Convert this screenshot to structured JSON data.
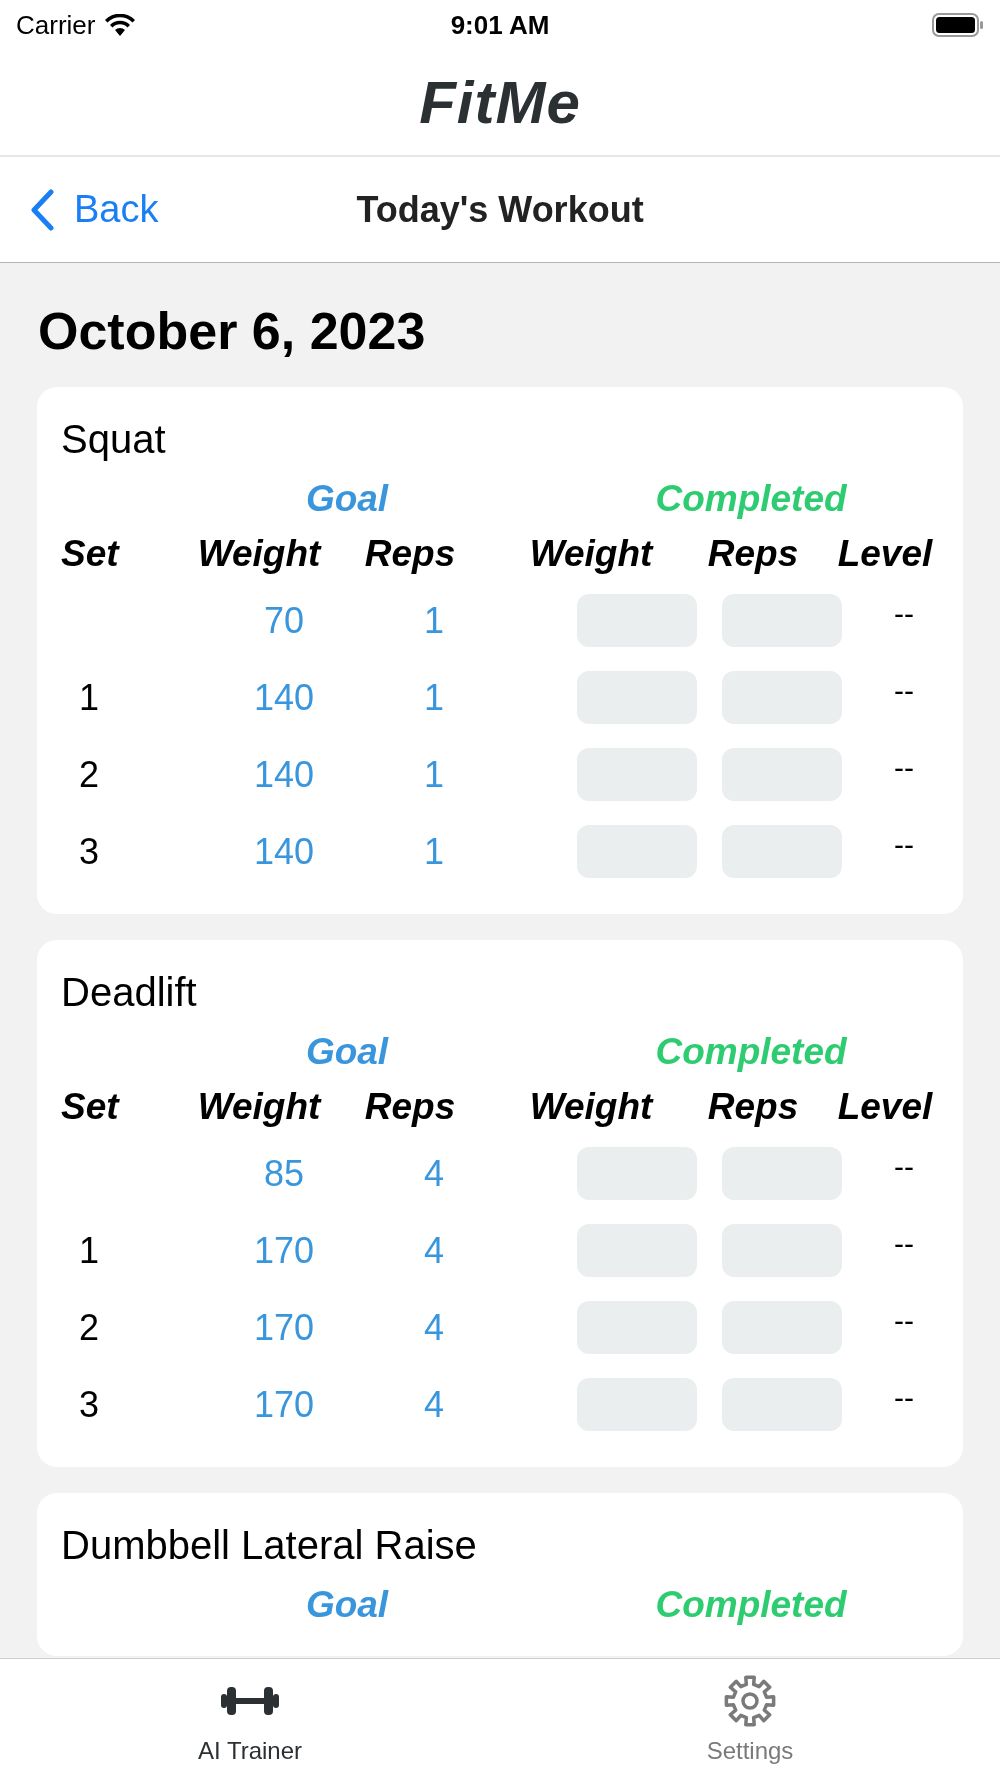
{
  "status_bar": {
    "carrier": "Carrier",
    "time": "9:01 AM"
  },
  "app_title": "FitMe",
  "nav": {
    "back": "Back",
    "title": "Today's Workout"
  },
  "date": "October 6, 2023",
  "exercises": [
    {
      "name": "Squat",
      "goal_label": "Goal",
      "completed_label": "Completed",
      "columns": [
        "Set",
        "Weight",
        "Reps",
        "Weight",
        "Reps",
        "Level"
      ],
      "sets": [
        {
          "goal_weight": "70",
          "goal_reps": "1",
          "level": "--"
        },
        {
          "set": "1",
          "goal_weight": "140",
          "goal_reps": "1",
          "level": "--"
        },
        {
          "set": "2",
          "goal_weight": "140",
          "goal_reps": "1",
          "level": "--"
        },
        {
          "set": "3",
          "goal_weight": "140",
          "goal_reps": "1",
          "level": "--"
        }
      ]
    },
    {
      "name": "Deadlift",
      "goal_label": "Goal",
      "completed_label": "Completed",
      "columns": [
        "Set",
        "Weight",
        "Reps",
        "Weight",
        "Reps",
        "Level"
      ],
      "sets": [
        {
          "goal_weight": "85",
          "goal_reps": "4",
          "level": "--"
        },
        {
          "set": "1",
          "goal_weight": "170",
          "goal_reps": "4",
          "level": "--"
        },
        {
          "set": "2",
          "goal_weight": "170",
          "goal_reps": "4",
          "level": "--"
        },
        {
          "set": "3",
          "goal_weight": "170",
          "goal_reps": "4",
          "level": "--"
        }
      ]
    },
    {
      "name": "Dumbbell Lateral Raise",
      "goal_label": "Goal",
      "completed_label": "Completed"
    }
  ],
  "tabs": [
    {
      "label": "AI Trainer",
      "kind": "dumbbell",
      "selected": true
    },
    {
      "label": "Settings",
      "kind": "gear",
      "selected": false
    }
  ]
}
